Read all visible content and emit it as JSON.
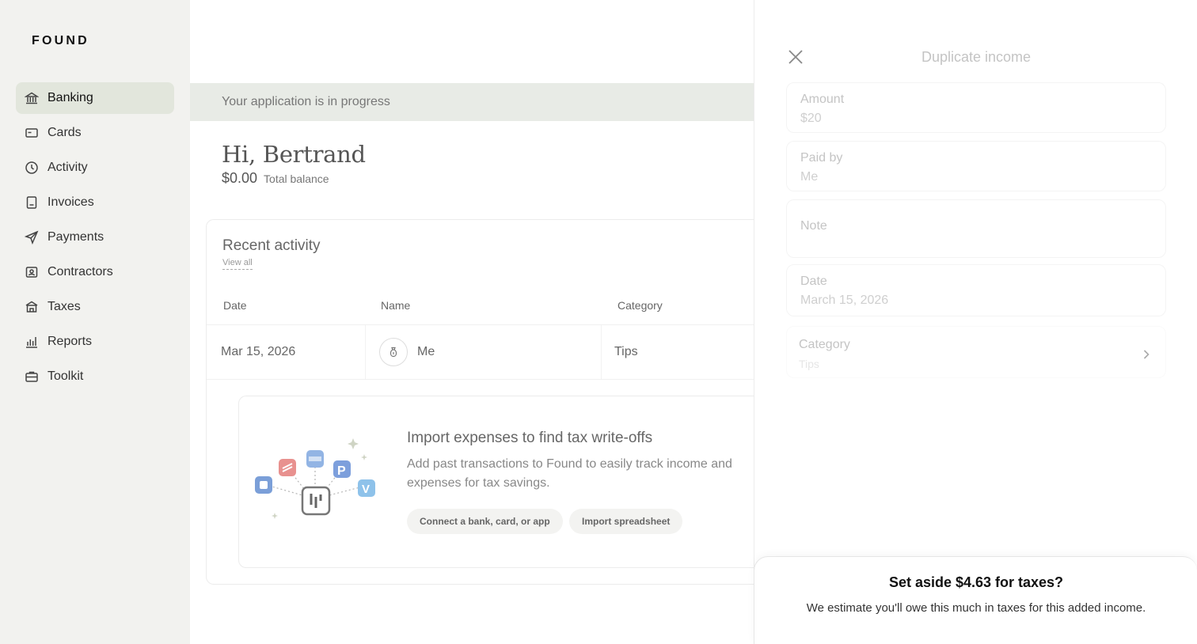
{
  "brand": {
    "logo": "FOUND"
  },
  "sidebar": {
    "items": [
      {
        "label": "Banking",
        "icon": "bank-icon",
        "active": true
      },
      {
        "label": "Cards",
        "icon": "card-icon"
      },
      {
        "label": "Activity",
        "icon": "clock-icon"
      },
      {
        "label": "Invoices",
        "icon": "invoice-icon"
      },
      {
        "label": "Payments",
        "icon": "send-icon"
      },
      {
        "label": "Contractors",
        "icon": "contractor-icon"
      },
      {
        "label": "Taxes",
        "icon": "taxes-icon"
      },
      {
        "label": "Reports",
        "icon": "bar-chart-icon"
      },
      {
        "label": "Toolkit",
        "icon": "briefcase-icon"
      }
    ]
  },
  "main": {
    "banner": "Your application is in progress",
    "greeting": "Hi, Bertrand",
    "balance_amount": "$0.00",
    "balance_label": "Total balance",
    "activity": {
      "title": "Recent activity",
      "view_all": "View all",
      "columns": [
        "Date",
        "Name",
        "Category"
      ],
      "rows": [
        {
          "date": "Mar 15, 2026",
          "name": "Me",
          "category": "Tips"
        }
      ]
    },
    "import": {
      "title": "Import expenses to find tax write-offs",
      "description": "Add past transactions to Found to easily track income and expenses for tax savings.",
      "connect_label": "Connect a bank, card, or app",
      "spreadsheet_label": "Import spreadsheet"
    }
  },
  "panel": {
    "title": "Duplicate income",
    "fields": {
      "amount": {
        "label": "Amount",
        "value": "$20"
      },
      "paid_by": {
        "label": "Paid by",
        "value": "Me"
      },
      "note": {
        "label": "Note",
        "value": ""
      },
      "date": {
        "label": "Date",
        "value": "March 15, 2026"
      },
      "category": {
        "label": "Category",
        "value": "Tips"
      }
    }
  },
  "tax_prompt": {
    "title": "Set aside $4.63 for taxes?",
    "description": "We estimate you'll owe this much in taxes for this added income."
  },
  "colors": {
    "sidebar_bg": "#f2f2ef",
    "active_item": "#e2e6dc",
    "banner_bg": "#e8ebe6"
  }
}
